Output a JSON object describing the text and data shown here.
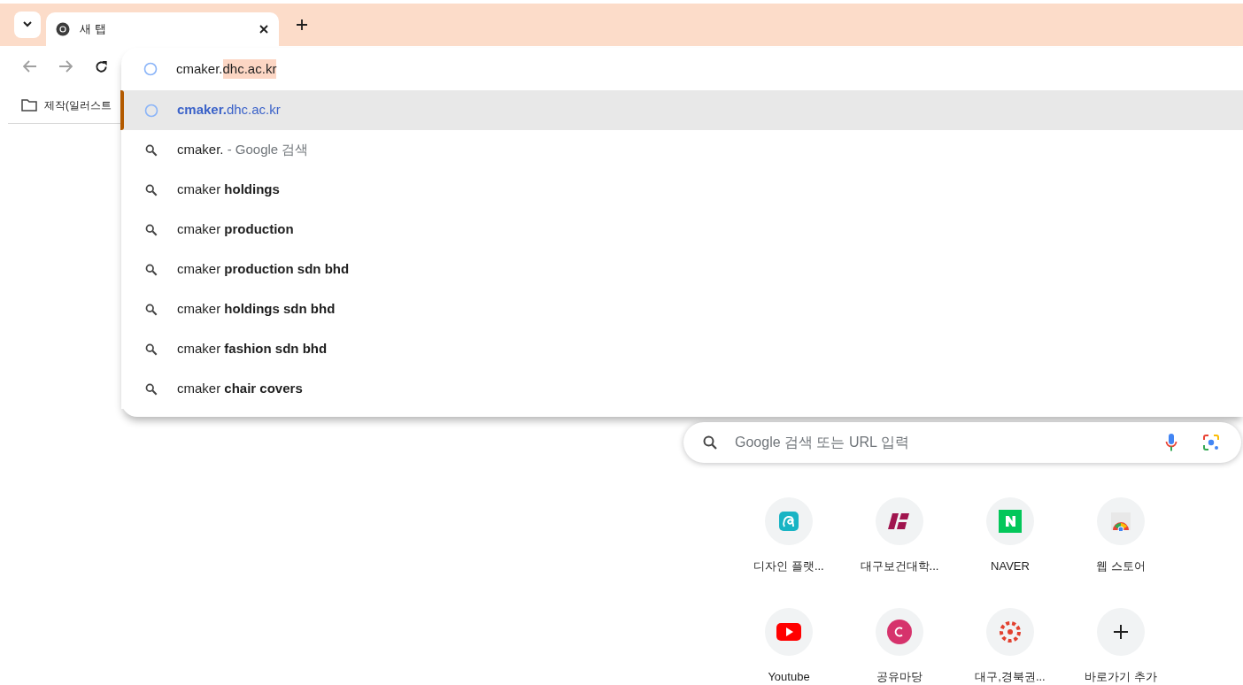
{
  "tab_strip": {
    "tabs": [
      {
        "title": "새 탭",
        "selected": true
      }
    ]
  },
  "bookmarks_bar": {
    "items": [
      {
        "label": "제작(일러스트"
      }
    ]
  },
  "omnibox": {
    "typed": "cmaker.",
    "autocomplete": "dhc.ac.kr",
    "suggestions": [
      {
        "kind": "url",
        "text": "**cmaker.**dhc.ac.kr",
        "selected": true
      },
      {
        "kind": "search",
        "text": "cmaker.",
        "description": " - Google 검색",
        "selected": false
      },
      {
        "kind": "search",
        "text": "cmaker **holdings**",
        "selected": false
      },
      {
        "kind": "search",
        "text": "cmaker **production**",
        "selected": false
      },
      {
        "kind": "search",
        "text": "cmaker **production sdn bhd**",
        "selected": false
      },
      {
        "kind": "search",
        "text": "cmaker **holdings sdn bhd**",
        "selected": false
      },
      {
        "kind": "search",
        "text": "cmaker **fashion sdn bhd**",
        "selected": false
      },
      {
        "kind": "search",
        "text": "cmaker **chair covers**",
        "selected": false
      }
    ]
  },
  "search_box": {
    "placeholder": "Google 검색 또는 URL 입력"
  },
  "shortcuts": [
    {
      "kind": "loop",
      "label": "디자인 플랫..."
    },
    {
      "kind": "stripes",
      "label": "대구보건대학..."
    },
    {
      "kind": "n",
      "label": "NAVER"
    },
    {
      "kind": "store",
      "label": "웹 스토어"
    },
    {
      "kind": "play",
      "label": "Youtube"
    },
    {
      "kind": "c",
      "label": "공유마당"
    },
    {
      "kind": "ring",
      "label": "대구,경북권..."
    },
    {
      "kind": "add",
      "label": "바로가기 추가"
    }
  ]
}
